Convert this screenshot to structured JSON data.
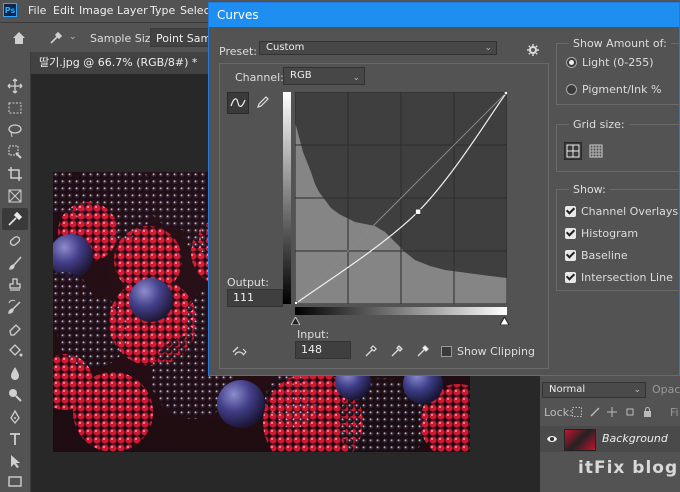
{
  "menubar": {
    "logo": "Ps",
    "items": [
      "File",
      "Edit",
      "Image",
      "Layer",
      "Type",
      "Select"
    ]
  },
  "options": {
    "sample_size_label": "Sample Size:",
    "sample_size_value": "Point Sample"
  },
  "document": {
    "tab_title": "딸기.jpg @ 66.7% (RGB/8#) *"
  },
  "curves": {
    "title": "Curves",
    "preset_label": "Preset:",
    "preset_value": "Custom",
    "channel_label": "Channel:",
    "channel_value": "RGB",
    "output_label": "Output:",
    "output_value": "111",
    "input_label": "Input:",
    "input_value": "148",
    "show_clipping_label": "Show Clipping",
    "show_clipping_checked": false,
    "show_amount": {
      "title": "Show Amount of:",
      "option_light": "Light  (0-255)",
      "option_pigment": "Pigment/Ink %",
      "selected": "light"
    },
    "grid_size": {
      "title": "Grid size:",
      "selected": "simple"
    },
    "show": {
      "title": "Show:",
      "items": [
        {
          "label": "Channel Overlays",
          "checked": true
        },
        {
          "label": "Histogram",
          "checked": true
        },
        {
          "label": "Baseline",
          "checked": true
        },
        {
          "label": "Intersection Line",
          "checked": true
        }
      ]
    },
    "curve_points": [
      {
        "input": 0,
        "output": 0
      },
      {
        "input": 148,
        "output": 111
      },
      {
        "input": 255,
        "output": 255
      }
    ]
  },
  "layers": {
    "blend_mode": "Normal",
    "opacity_label": "Opaci",
    "lock_label": "Lock:",
    "fill_label": "Fi",
    "layer_name": "Background"
  },
  "watermark": "itFix blog",
  "colors": {
    "accent": "#1f8ef1",
    "panel": "#535353",
    "workspace": "#282828"
  }
}
